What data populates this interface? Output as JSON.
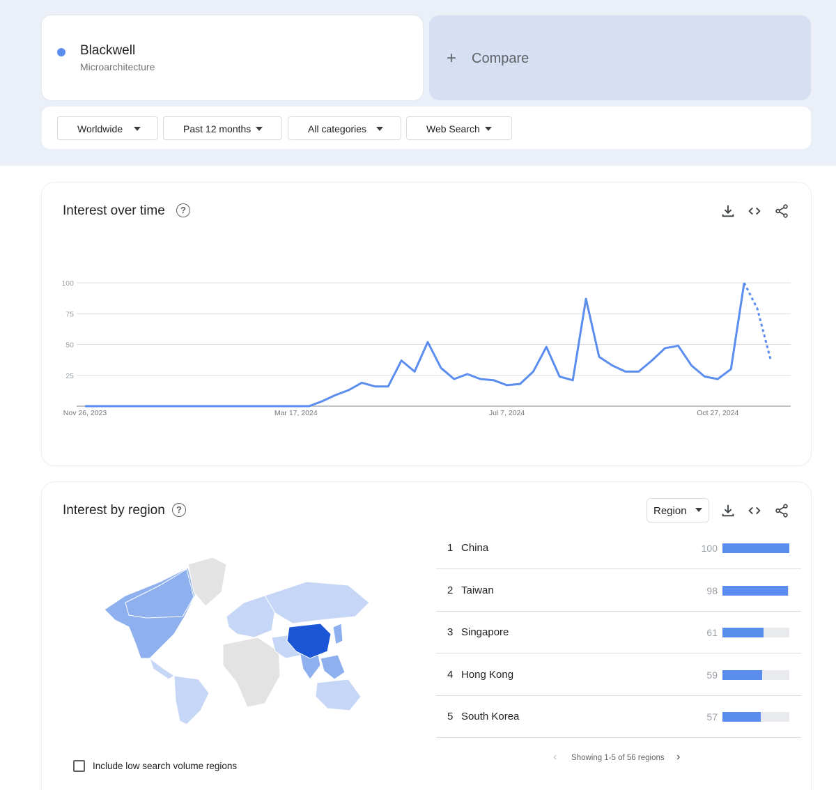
{
  "search_term": {
    "name": "Blackwell",
    "type": "Microarchitecture",
    "color": "#5b8def"
  },
  "compare": {
    "plus": "+",
    "label": "Compare"
  },
  "filters": [
    {
      "label": "Worldwide"
    },
    {
      "label": "Past 12 months"
    },
    {
      "label": "All categories"
    },
    {
      "label": "Web Search"
    }
  ],
  "interest_over_time": {
    "title": "Interest over time",
    "icons": [
      "download-icon",
      "embed-code-icon",
      "share-icon"
    ]
  },
  "chart_data": {
    "type": "line",
    "ylim": [
      0,
      100
    ],
    "yticks": [
      100,
      75,
      50,
      25
    ],
    "xtick_labels": [
      "Nov 26, 2023",
      "Mar 17, 2024",
      "Jul 7, 2024",
      "Oct 27, 2024"
    ],
    "series_color": "#5b8def",
    "x": [
      "2023-11-26",
      "2023-12-03",
      "2023-12-10",
      "2023-12-17",
      "2023-12-24",
      "2023-12-31",
      "2024-01-07",
      "2024-01-14",
      "2024-01-21",
      "2024-01-28",
      "2024-02-04",
      "2024-02-11",
      "2024-02-18",
      "2024-02-25",
      "2024-03-03",
      "2024-03-10",
      "2024-03-17",
      "2024-03-24",
      "2024-03-31",
      "2024-04-07",
      "2024-04-14",
      "2024-04-21",
      "2024-04-28",
      "2024-05-05",
      "2024-05-12",
      "2024-05-19",
      "2024-05-26",
      "2024-06-02",
      "2024-06-09",
      "2024-06-16",
      "2024-06-23",
      "2024-06-30",
      "2024-07-07",
      "2024-07-14",
      "2024-07-21",
      "2024-07-28",
      "2024-08-04",
      "2024-08-11",
      "2024-08-18",
      "2024-08-25",
      "2024-09-01",
      "2024-09-08",
      "2024-09-15",
      "2024-09-22",
      "2024-09-29",
      "2024-10-06",
      "2024-10-13",
      "2024-10-20",
      "2024-10-27",
      "2024-11-03",
      "2024-11-10",
      "2024-11-17",
      "2024-11-24"
    ],
    "values": [
      0,
      0,
      0,
      0,
      0,
      0,
      0,
      0,
      0,
      0,
      0,
      0,
      0,
      0,
      0,
      0,
      0,
      0,
      4,
      9,
      13,
      19,
      16,
      16,
      37,
      28,
      52,
      31,
      22,
      26,
      22,
      21,
      17,
      18,
      28,
      48,
      24,
      21,
      87,
      40,
      33,
      28,
      28,
      37,
      47,
      49,
      33,
      24,
      22,
      30,
      100,
      79,
      38
    ],
    "partial_from_index": 50
  },
  "interest_by_region": {
    "title": "Interest by region",
    "region_selector": "Region",
    "icons": [
      "download-icon",
      "embed-code-icon",
      "share-icon"
    ],
    "rows": [
      {
        "rank": "1",
        "name": "China",
        "value": 100
      },
      {
        "rank": "2",
        "name": "Taiwan",
        "value": 98
      },
      {
        "rank": "3",
        "name": "Singapore",
        "value": 61
      },
      {
        "rank": "4",
        "name": "Hong Kong",
        "value": 59
      },
      {
        "rank": "5",
        "name": "South Korea",
        "value": 57
      }
    ],
    "pager": "Showing 1-5 of 56 regions",
    "low_volume_label": "Include low search volume regions",
    "map_colors": {
      "high": "#1a56d6",
      "mid": "#8fb0ee",
      "low": "#c6d6f6",
      "none": "#e3e3e3"
    }
  }
}
